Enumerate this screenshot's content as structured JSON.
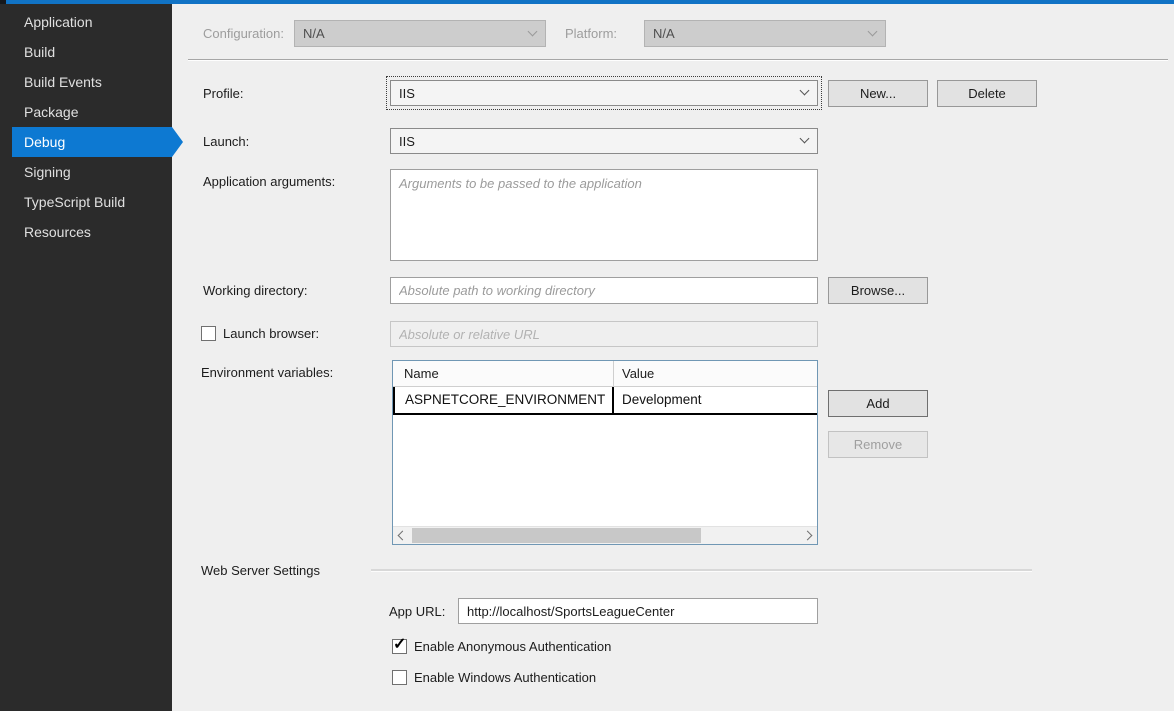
{
  "colors": {
    "accent_bar": "#1173c5",
    "sidebar_bg": "#2b2b2b",
    "selected_item_bg": "#0d79d2",
    "grid_border": "#7097b4"
  },
  "sidebar": {
    "items": [
      {
        "label": "Application",
        "selected": false
      },
      {
        "label": "Build",
        "selected": false
      },
      {
        "label": "Build Events",
        "selected": false
      },
      {
        "label": "Package",
        "selected": false
      },
      {
        "label": "Debug",
        "selected": true
      },
      {
        "label": "Signing",
        "selected": false
      },
      {
        "label": "TypeScript Build",
        "selected": false
      },
      {
        "label": "Resources",
        "selected": false
      }
    ]
  },
  "header": {
    "configuration_label": "Configuration:",
    "configuration_value": "N/A",
    "platform_label": "Platform:",
    "platform_value": "N/A"
  },
  "form": {
    "profile": {
      "label": "Profile:",
      "value": "IIS"
    },
    "new_button": "New...",
    "delete_button": "Delete",
    "launch": {
      "label": "Launch:",
      "value": "IIS"
    },
    "application_arguments": {
      "label": "Application arguments:",
      "placeholder": "Arguments to be passed to the application"
    },
    "working_directory": {
      "label": "Working directory:",
      "placeholder": "Absolute path to working directory",
      "browse_button": "Browse..."
    },
    "launch_browser": {
      "label": "Launch browser:",
      "checked": false,
      "placeholder": "Absolute or relative URL"
    },
    "environment_variables": {
      "label": "Environment variables:",
      "columns": [
        "Name",
        "Value"
      ],
      "rows": [
        {
          "name": "ASPNETCORE_ENVIRONMENT",
          "value": "Development"
        }
      ],
      "add_button": "Add",
      "remove_button": "Remove",
      "remove_disabled": true
    }
  },
  "web_server": {
    "section_label": "Web Server Settings",
    "app_url_label": "App URL:",
    "app_url_value": "http://localhost/SportsLeagueCenter",
    "anonymous_auth": {
      "label": "Enable Anonymous Authentication",
      "checked": true
    },
    "windows_auth": {
      "label": "Enable Windows Authentication",
      "checked": false
    }
  },
  "icons": {
    "checkmark": "✓",
    "combo_chevron": "chevron-down",
    "scroll_left": "chevron-left",
    "scroll_right": "chevron-right"
  }
}
